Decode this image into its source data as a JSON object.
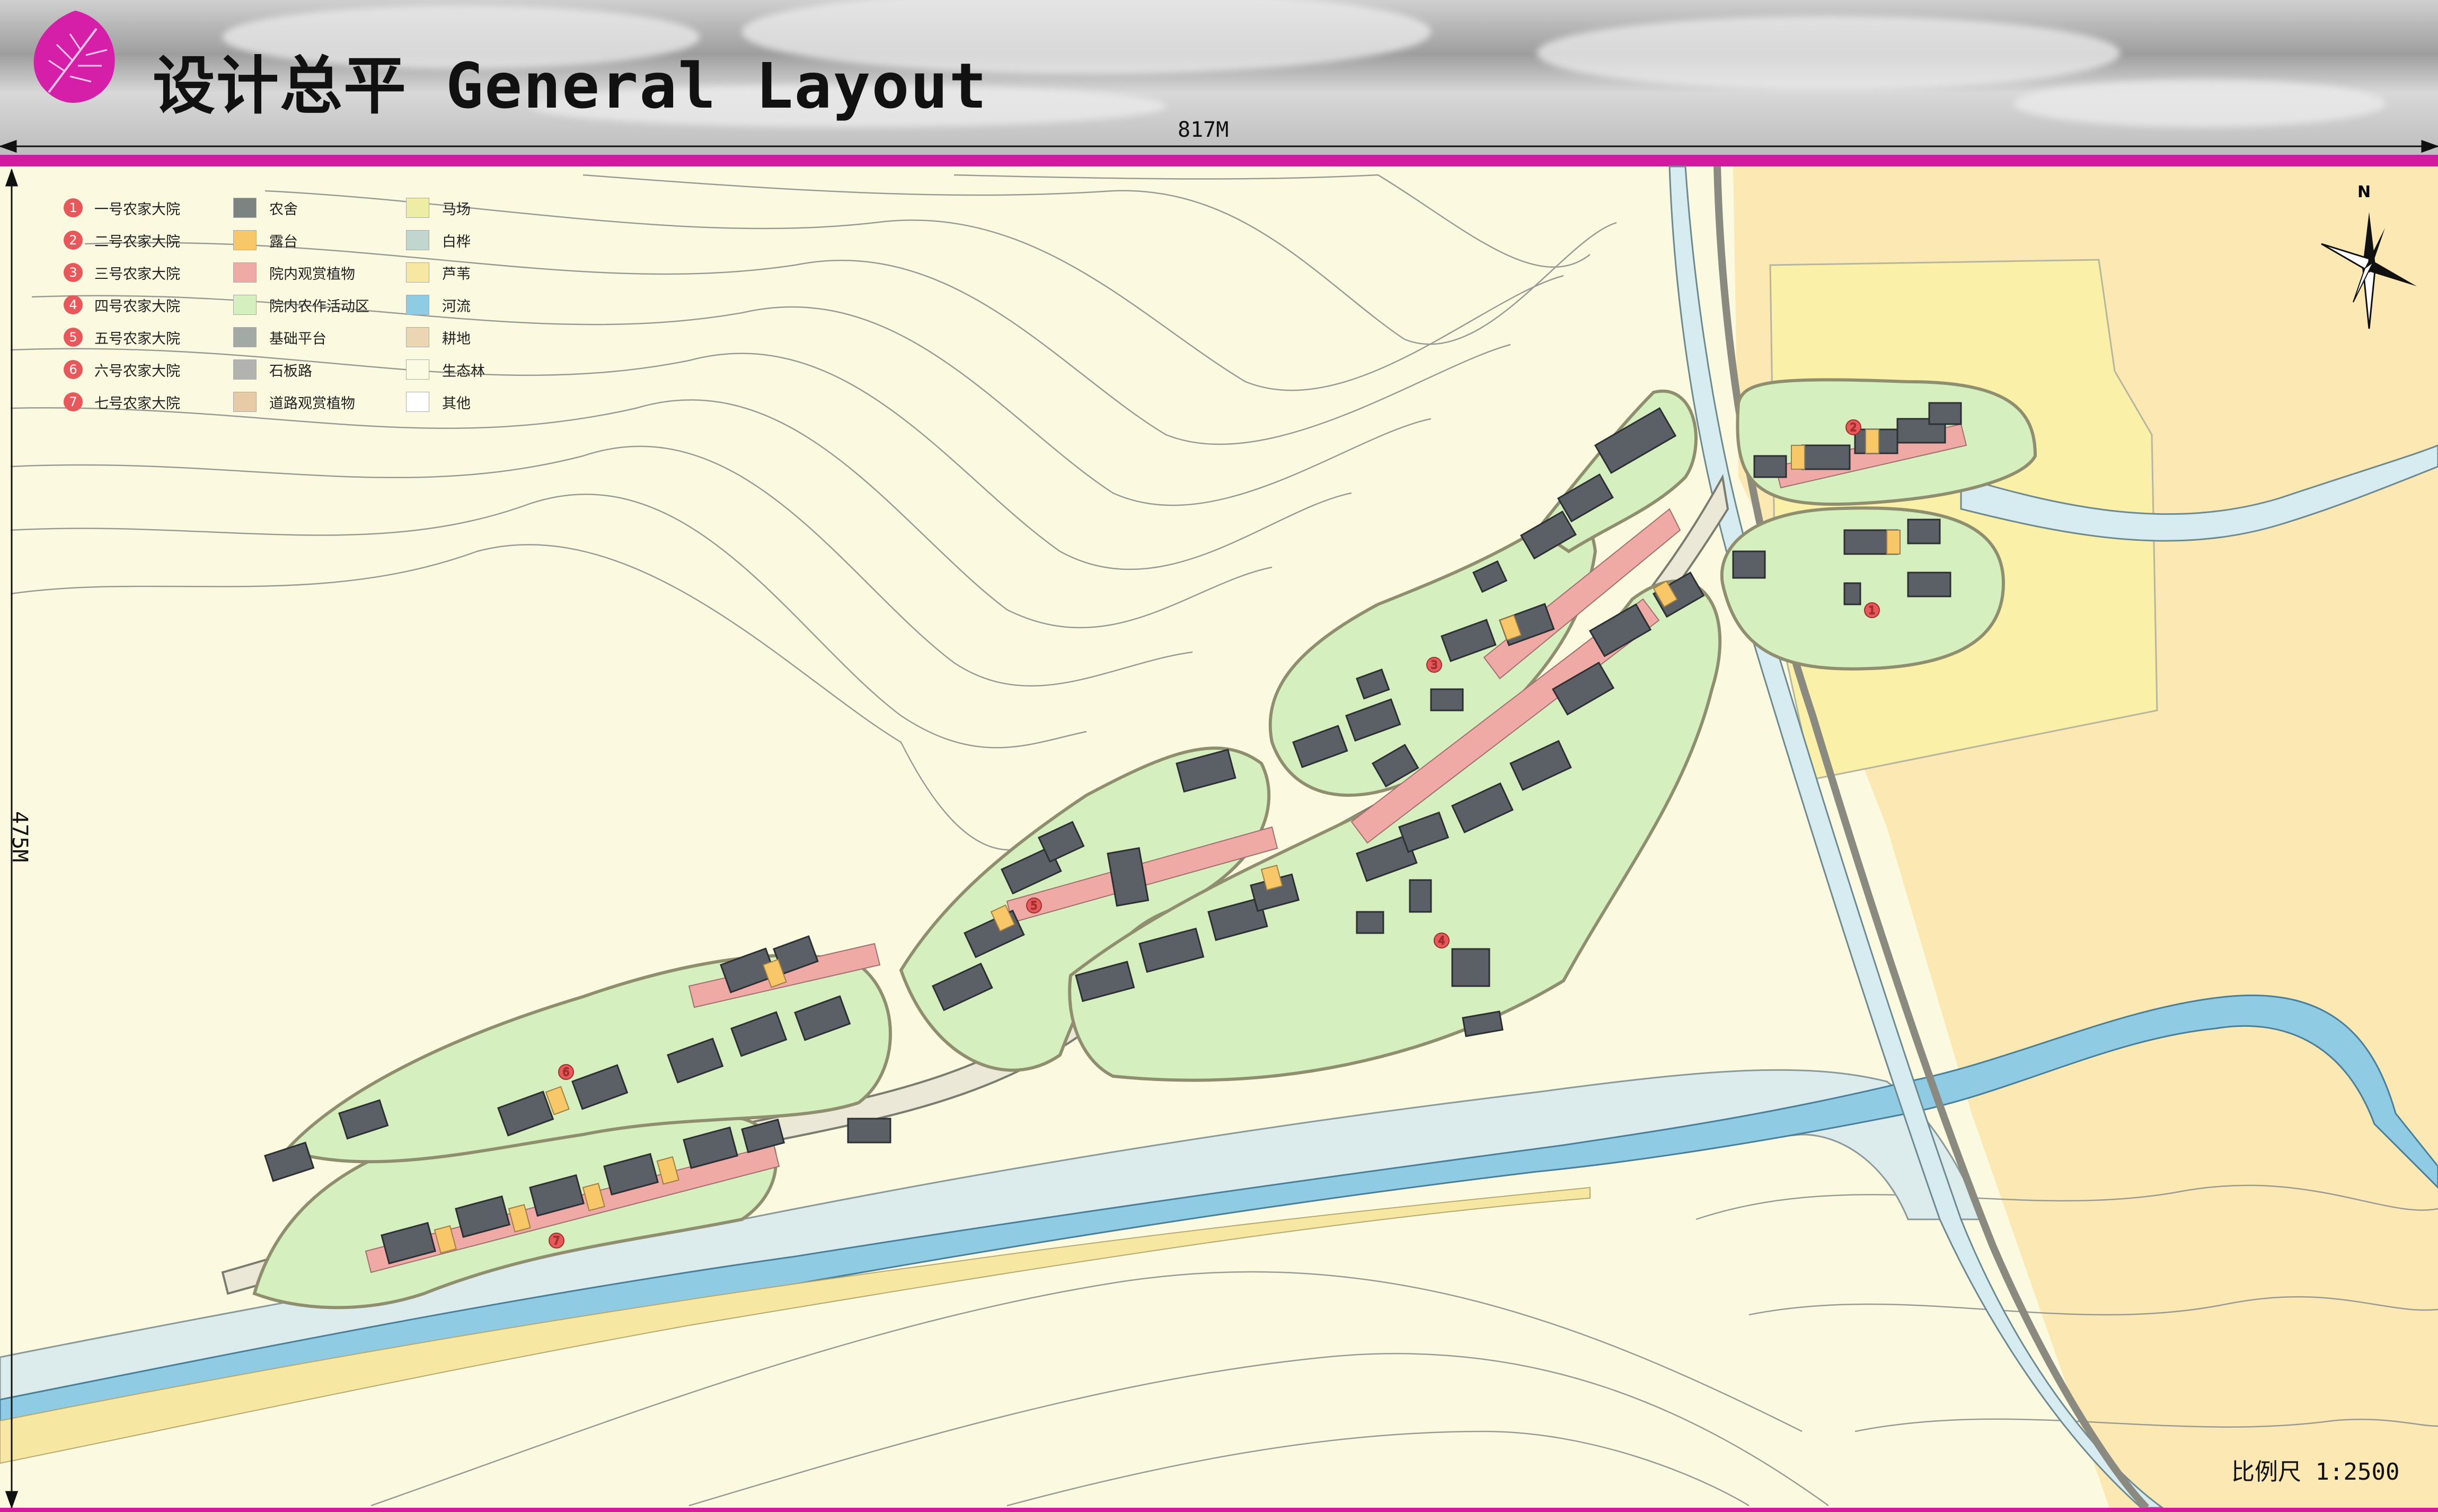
{
  "header": {
    "title": "设计总平 General Layout"
  },
  "dimensions": {
    "width_label": "817M",
    "height_label": "475M"
  },
  "legend": {
    "courtyards": [
      {
        "num": "1",
        "label": "一号农家大院"
      },
      {
        "num": "2",
        "label": "二号农家大院"
      },
      {
        "num": "3",
        "label": "三号农家大院"
      },
      {
        "num": "4",
        "label": "四号农家大院"
      },
      {
        "num": "5",
        "label": "五号农家大院"
      },
      {
        "num": "6",
        "label": "六号农家大院"
      },
      {
        "num": "7",
        "label": "七号农家大院"
      }
    ],
    "features": [
      {
        "label": "农舍",
        "color": "#7c8380"
      },
      {
        "label": "露台",
        "color": "#f7c768"
      },
      {
        "label": "院内观赏植物",
        "color": "#f0aaa6"
      },
      {
        "label": "院内农作活动区",
        "color": "#d6efbf"
      },
      {
        "label": "基础平台",
        "color": "#a3aaa6"
      },
      {
        "label": "石板路",
        "color": "#b2b2ae"
      },
      {
        "label": "道路观赏植物",
        "color": "#e7cba6"
      }
    ],
    "landuse": [
      {
        "label": "马场",
        "color": "#eeeda6"
      },
      {
        "label": "白桦",
        "color": "#c2d6d0"
      },
      {
        "label": "芦苇",
        "color": "#f6e8a2"
      },
      {
        "label": "河流",
        "color": "#8fcce4"
      },
      {
        "label": "耕地",
        "color": "#ead6b2"
      },
      {
        "label": "生态林",
        "color": "#fbfae2"
      },
      {
        "label": "其他",
        "color": "#ffffff"
      }
    ]
  },
  "map": {
    "north_label": "N",
    "courtyard_markers": [
      "1",
      "2",
      "3",
      "4",
      "5",
      "6",
      "7"
    ],
    "scale_label": "比例尺 1:2500"
  },
  "colors": {
    "accent": "#d21aa0",
    "farmhouse": "#5b6066",
    "terrace": "#f7c768",
    "yard": "#d6efbf",
    "river": "#8fcce4",
    "field": "#fbe8b2",
    "forest": "#fbfae0"
  }
}
